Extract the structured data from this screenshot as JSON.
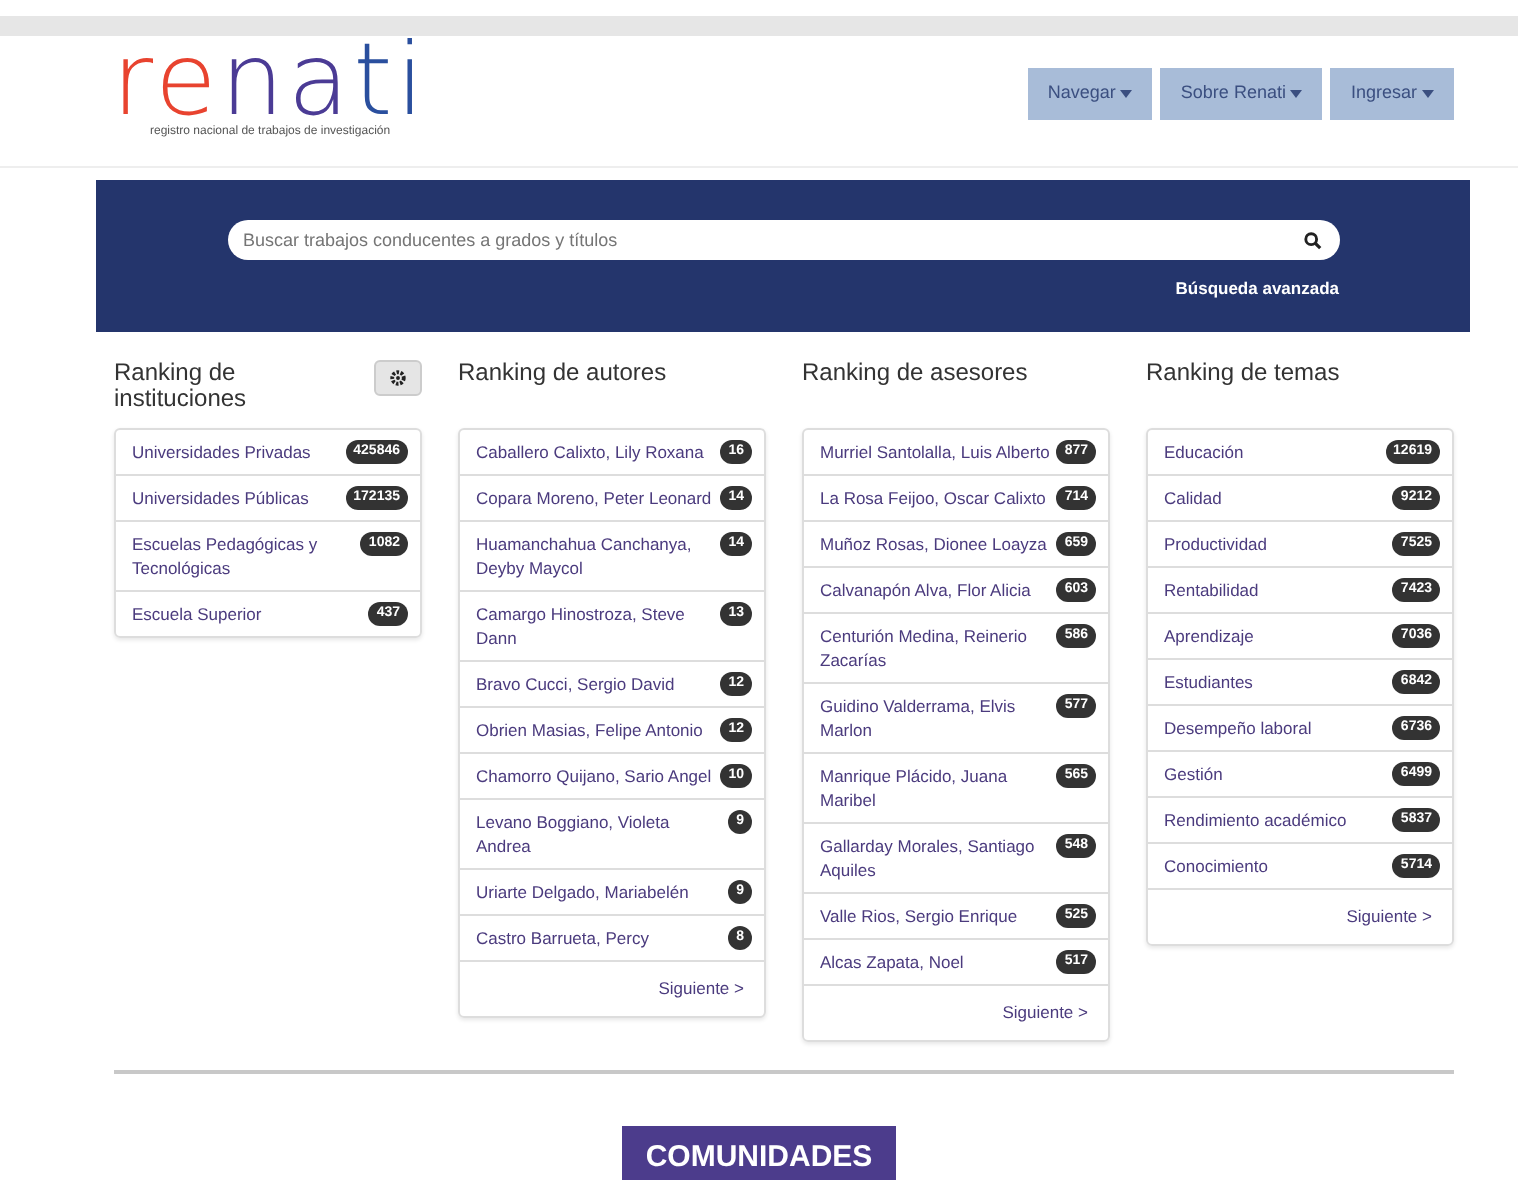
{
  "logo": {
    "parts": [
      {
        "text": "re",
        "color": "#e8432f"
      },
      {
        "text": "na",
        "color": "#4b3b95"
      },
      {
        "text": "ti",
        "color": "#2a4f9e"
      }
    ],
    "tagline": "registro nacional de trabajos de investigación"
  },
  "nav": [
    {
      "label": "Navegar"
    },
    {
      "label": "Sobre Renati"
    },
    {
      "label": "Ingresar"
    }
  ],
  "search": {
    "placeholder": "Buscar trabajos conducentes a grados y títulos",
    "advanced_link": "Búsqueda avanzada"
  },
  "rankings": [
    {
      "title": "Ranking de instituciones",
      "settings": true,
      "items": [
        {
          "label": "Universidades Privadas",
          "count": "425846"
        },
        {
          "label": "Universidades Públicas",
          "count": "172135"
        },
        {
          "label": "Escuelas Pedagógicas y Tecnológicas",
          "count": "1082"
        },
        {
          "label": "Escuela Superior",
          "count": "437"
        }
      ]
    },
    {
      "title": "Ranking de autores",
      "settings": false,
      "items": [
        {
          "label": "Caballero Calixto, Lily Roxana",
          "count": "16"
        },
        {
          "label": "Copara Moreno, Peter Leonard",
          "count": "14"
        },
        {
          "label": "Huamanchahua Canchanya, Deyby Maycol",
          "count": "14"
        },
        {
          "label": "Camargo Hinostroza, Steve Dann",
          "count": "13"
        },
        {
          "label": "Bravo Cucci, Sergio David",
          "count": "12"
        },
        {
          "label": "Obrien Masias, Felipe Antonio",
          "count": "12"
        },
        {
          "label": "Chamorro Quijano, Sario Angel",
          "count": "10"
        },
        {
          "label": "Levano Boggiano, Violeta Andrea",
          "count": "9"
        },
        {
          "label": "Uriarte Delgado, Mariabelén",
          "count": "9"
        },
        {
          "label": "Castro Barrueta, Percy",
          "count": "8"
        }
      ],
      "next_link": "Siguiente >"
    },
    {
      "title": "Ranking de asesores",
      "settings": false,
      "items": [
        {
          "label": "Murriel Santolalla, Luis Alberto",
          "count": "877"
        },
        {
          "label": "La Rosa Feijoo, Oscar Calixto",
          "count": "714"
        },
        {
          "label": "Muñoz Rosas, Dionee Loayza",
          "count": "659"
        },
        {
          "label": "Calvanapón Alva, Flor Alicia",
          "count": "603"
        },
        {
          "label": "Centurión Medina, Reinerio Zacarías",
          "count": "586"
        },
        {
          "label": "Guidino Valderrama, Elvis Marlon",
          "count": "577"
        },
        {
          "label": "Manrique Plácido, Juana Maribel",
          "count": "565"
        },
        {
          "label": "Gallarday Morales, Santiago Aquiles",
          "count": "548"
        },
        {
          "label": "Valle Rios, Sergio Enrique",
          "count": "525"
        },
        {
          "label": "Alcas Zapata, Noel",
          "count": "517"
        }
      ],
      "next_link": "Siguiente >"
    },
    {
      "title": "Ranking de temas",
      "settings": false,
      "items": [
        {
          "label": "Educación",
          "count": "12619"
        },
        {
          "label": "Calidad",
          "count": "9212"
        },
        {
          "label": "Productividad",
          "count": "7525"
        },
        {
          "label": "Rentabilidad",
          "count": "7423"
        },
        {
          "label": "Aprendizaje",
          "count": "7036"
        },
        {
          "label": "Estudiantes",
          "count": "6842"
        },
        {
          "label": "Desempeño laboral",
          "count": "6736"
        },
        {
          "label": "Gestión",
          "count": "6499"
        },
        {
          "label": "Rendimiento académico",
          "count": "5837"
        },
        {
          "label": "Conocimiento",
          "count": "5714"
        }
      ],
      "next_link": "Siguiente >"
    }
  ],
  "section_title": "COMUNIDADES"
}
